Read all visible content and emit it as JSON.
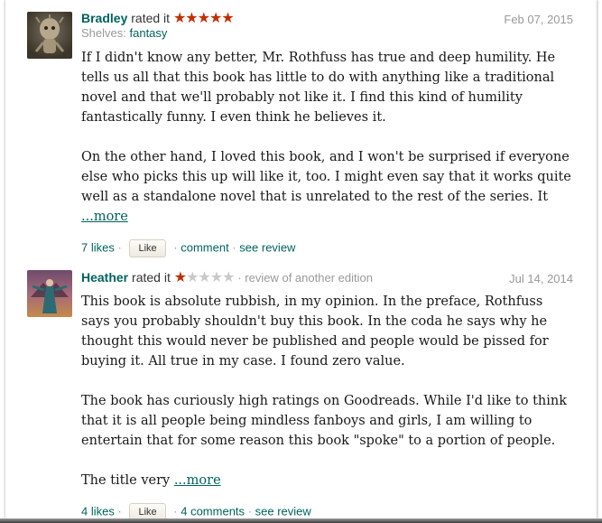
{
  "reviews": [
    {
      "user": "Bradley",
      "rated_text": "rated it",
      "stars_on": "★★★★★",
      "stars_off": "",
      "date": "Feb 07, 2015",
      "shelves_label": "Shelves:",
      "shelf": "fantasy",
      "paragraphs": [
        "If I didn't know any better, Mr. Rothfuss has true and deep humility. He tells us all that this book has little to do with anything like a traditional novel and that we'll probably not like it. I find this kind of humility fantastically funny. I even think he believes it.",
        "On the other hand, I loved this book, and I won't be surprised if everyone else who picks this up will like it, too. I might even say that it works quite well as a standalone novel that is unrelated to the rest of the series. It"
      ],
      "more": "...more",
      "likes": "7 likes",
      "like_button": "Like",
      "comment": "comment",
      "see_review": "see review",
      "rating": 5
    },
    {
      "user": "Heather",
      "rated_text": "rated it",
      "stars_on": "★",
      "stars_off": "★★★★",
      "edition_note": "review of another edition",
      "date": "Jul 14, 2014",
      "paragraphs": [
        "This book is absolute rubbish, in my opinion. In the preface, Rothfuss says you probably shouldn't buy this book. In the coda he says why he thought this would never be published and people would be pissed for buying it. All true in my case. I found zero value.",
        "The book has curiously high ratings on Goodreads. While I'd like to think that it is all people being mindless fanboys and girls, I am willing to entertain that for some reason this book \"spoke\" to a portion of people.",
        "The title very"
      ],
      "more": "...more",
      "likes": "4 likes",
      "like_button": "Like",
      "comment": "4 comments",
      "see_review": "see review",
      "rating": 1
    }
  ],
  "colors": {
    "link": "#00635d",
    "star": "#c42d00",
    "muted": "#999999"
  }
}
